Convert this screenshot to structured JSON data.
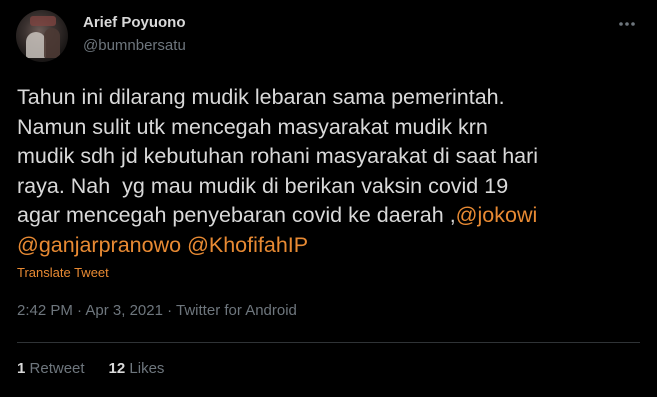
{
  "tweet": {
    "author": {
      "name": "Arief Poyuono",
      "handle": "@bumnbersatu"
    },
    "more_icon": "more-horizontal-icon",
    "text_lines": [
      "Tahun ini dilarang mudik lebaran sama pemerintah.",
      "Namun sulit utk mencegah masyarakat mudik krn",
      "mudik sdh jd kebutuhan rohani masyarakat di saat hari",
      "raya. Nah  yg mau mudik di berikan vaksin covid 19",
      "agar mencegah penyebaran covid ke daerah ,"
    ],
    "mentions": [
      "@jokowi",
      "@ganjarpranowo",
      "@KhofifahIP"
    ],
    "translate_label": "Translate Tweet",
    "time": "2:42 PM",
    "separator": " · ",
    "date": "Apr 3, 2021",
    "source": "Twitter for Android",
    "retweets": {
      "count": "1",
      "label": "Retweet"
    },
    "likes": {
      "count": "12",
      "label": "Likes"
    }
  },
  "colors": {
    "background": "#000000",
    "text": "#d9d9d9",
    "muted": "#6e767d",
    "accent": "#e88a33",
    "divider": "#2f3336"
  }
}
